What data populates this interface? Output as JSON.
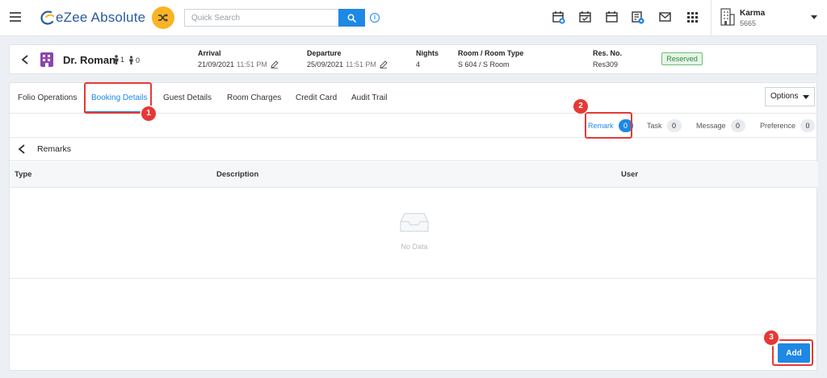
{
  "header": {
    "app_name": "eZee Absolute",
    "search": {
      "placeholder": "Quick Search",
      "value": ""
    },
    "property": {
      "name": "Karma",
      "code": "5665"
    },
    "icons": [
      "calendar-plus-icon",
      "calendar-check-icon",
      "calendar-icon",
      "calendar-settings-icon",
      "mail-icon",
      "apps-grid-icon"
    ]
  },
  "reservation": {
    "guest_name": "Dr. Roman",
    "adults": "1",
    "children": "0",
    "arrival_label": "Arrival",
    "arrival_date": "21/09/2021",
    "arrival_time": "11:51 PM",
    "departure_label": "Departure",
    "departure_date": "25/09/2021",
    "departure_time": "11:51 PM",
    "nights_label": "Nights",
    "nights": "4",
    "room_label": "Room / Room Type",
    "room": "S 604 / S Room",
    "resno_label": "Res. No.",
    "resno": "Res309",
    "status": "Reserved",
    "status_color": "#2e8b3a"
  },
  "tabs": [
    {
      "label": "Folio Operations",
      "active": false
    },
    {
      "label": "Booking Details",
      "active": true
    },
    {
      "label": "Guest Details",
      "active": false
    },
    {
      "label": "Room Charges",
      "active": false
    },
    {
      "label": "Credit Card",
      "active": false
    },
    {
      "label": "Audit Trail",
      "active": false
    }
  ],
  "options_label": "Options",
  "subtabs": [
    {
      "label": "Remark",
      "count": "0",
      "active": true
    },
    {
      "label": "Task",
      "count": "0",
      "active": false
    },
    {
      "label": "Message",
      "count": "0",
      "active": false
    },
    {
      "label": "Preference",
      "count": "0",
      "active": false
    }
  ],
  "remarks": {
    "title": "Remarks",
    "columns": [
      "Type",
      "Description",
      "User"
    ],
    "empty_text": "No Data",
    "add_label": "Add"
  },
  "annotations": [
    "1",
    "2",
    "3"
  ],
  "colors": {
    "accent": "#1e88e5",
    "highlight": "#e53935",
    "shuffle": "#f9b425"
  }
}
